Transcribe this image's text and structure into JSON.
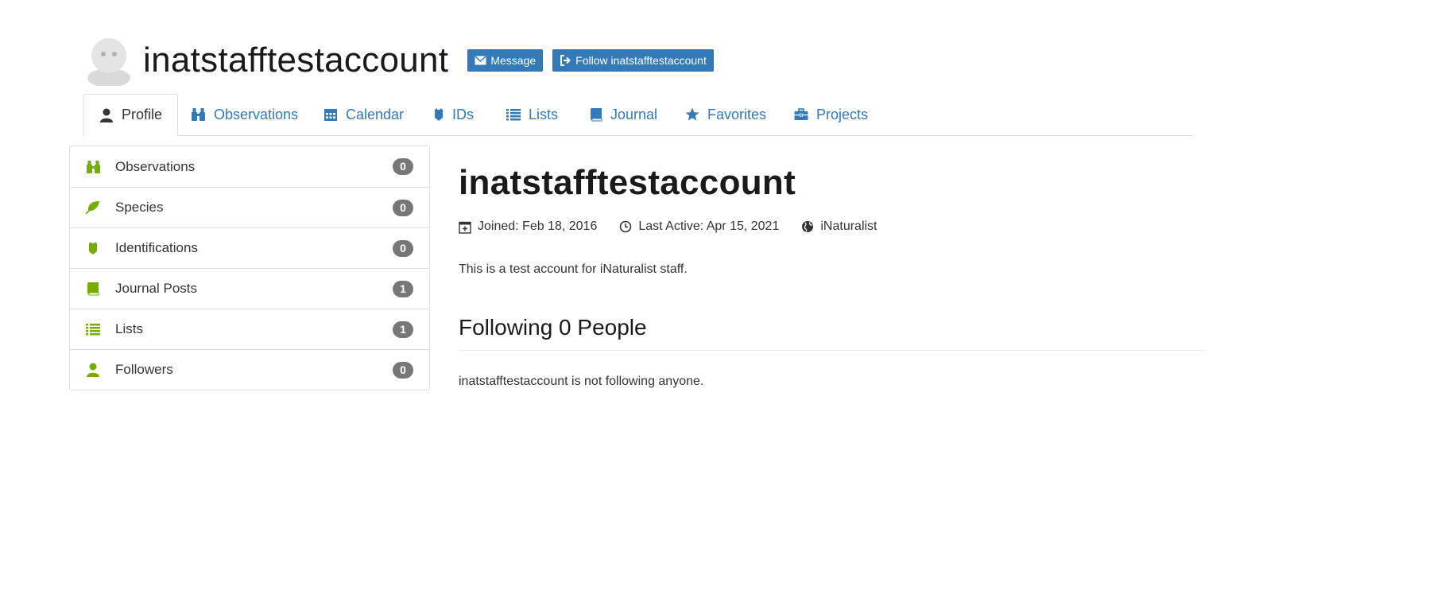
{
  "header": {
    "username": "inatstafftestaccount",
    "message_label": "Message",
    "follow_label": "Follow inatstafftestaccount"
  },
  "tabs": [
    {
      "label": "Profile",
      "icon": "person-icon",
      "active": true
    },
    {
      "label": "Observations",
      "icon": "binoculars-icon"
    },
    {
      "label": "Calendar",
      "icon": "calendar-icon"
    },
    {
      "label": "IDs",
      "icon": "identification-icon"
    },
    {
      "label": "Lists",
      "icon": "list-icon"
    },
    {
      "label": "Journal",
      "icon": "book-icon"
    },
    {
      "label": "Favorites",
      "icon": "star-icon"
    },
    {
      "label": "Projects",
      "icon": "briefcase-icon"
    }
  ],
  "sidebar": {
    "items": [
      {
        "label": "Observations",
        "count": "0",
        "icon": "binoculars-icon"
      },
      {
        "label": "Species",
        "count": "0",
        "icon": "leaf-icon"
      },
      {
        "label": "Identifications",
        "count": "0",
        "icon": "identification-icon"
      },
      {
        "label": "Journal Posts",
        "count": "1",
        "icon": "book-icon"
      },
      {
        "label": "Lists",
        "count": "1",
        "icon": "list-icon"
      },
      {
        "label": "Followers",
        "count": "0",
        "icon": "person-icon"
      }
    ]
  },
  "main": {
    "title": "inatstafftestaccount",
    "joined": "Joined: Feb 18, 2016",
    "last_active": "Last Active: Apr 15, 2021",
    "site": "iNaturalist",
    "description": "This is a test account for iNaturalist staff.",
    "following_heading": "Following 0 People",
    "following_text": "inatstafftestaccount is not following anyone."
  },
  "colors": {
    "link": "#337ab7",
    "button": "#337ab7",
    "sidebar_icon": "#74ac00",
    "badge": "#777777"
  }
}
